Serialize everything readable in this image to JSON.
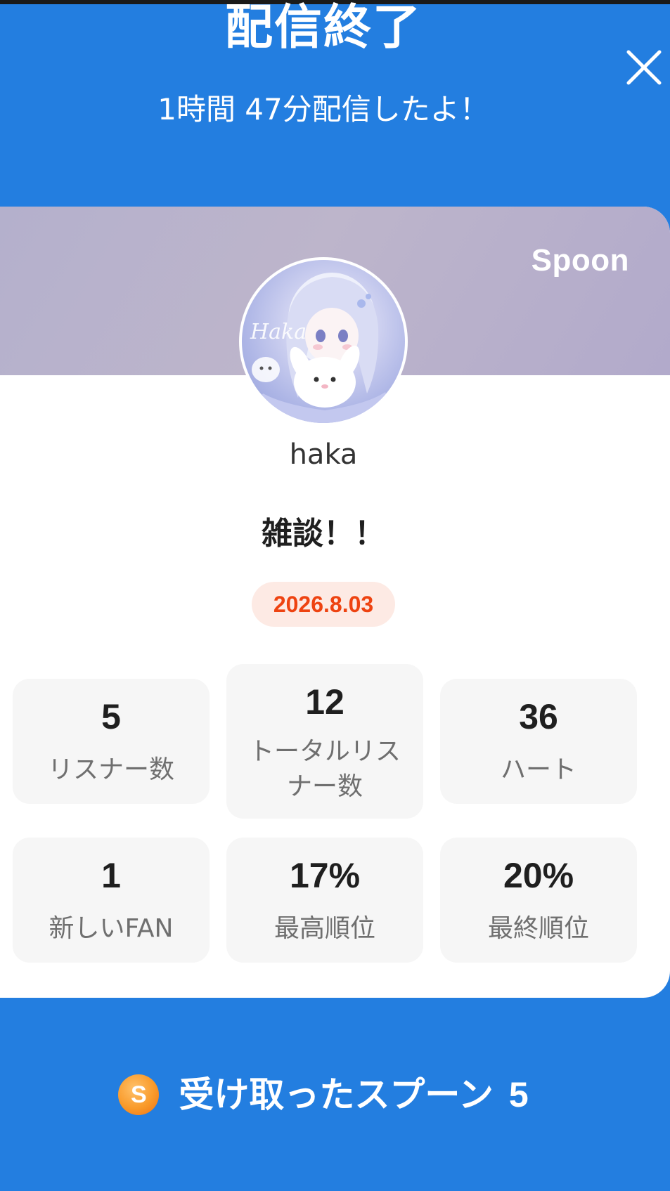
{
  "header": {
    "title": "配信終了",
    "subtitle": "1時間 47分配信したよ！",
    "close_icon": "close-icon"
  },
  "card": {
    "brand": "Spoon",
    "avatar_text": "Haka",
    "username": "haka",
    "stream_title": "雑談！！",
    "date": "2026.8.03"
  },
  "stats": [
    {
      "value": "5",
      "label": "リスナー数"
    },
    {
      "value": "12",
      "label": "トータルリスナー数"
    },
    {
      "value": "36",
      "label": "ハート"
    },
    {
      "value": "1",
      "label": "新しいFAN"
    },
    {
      "value": "17%",
      "label": "最高順位"
    },
    {
      "value": "20%",
      "label": "最終順位"
    }
  ],
  "spoons": {
    "coin_letter": "S",
    "label": "受け取ったスプーン",
    "count": "5"
  },
  "colors": {
    "background": "#237ee0",
    "badge_text": "#ee4311",
    "badge_bg": "#fdeae4",
    "coin": "#f99a2a"
  }
}
